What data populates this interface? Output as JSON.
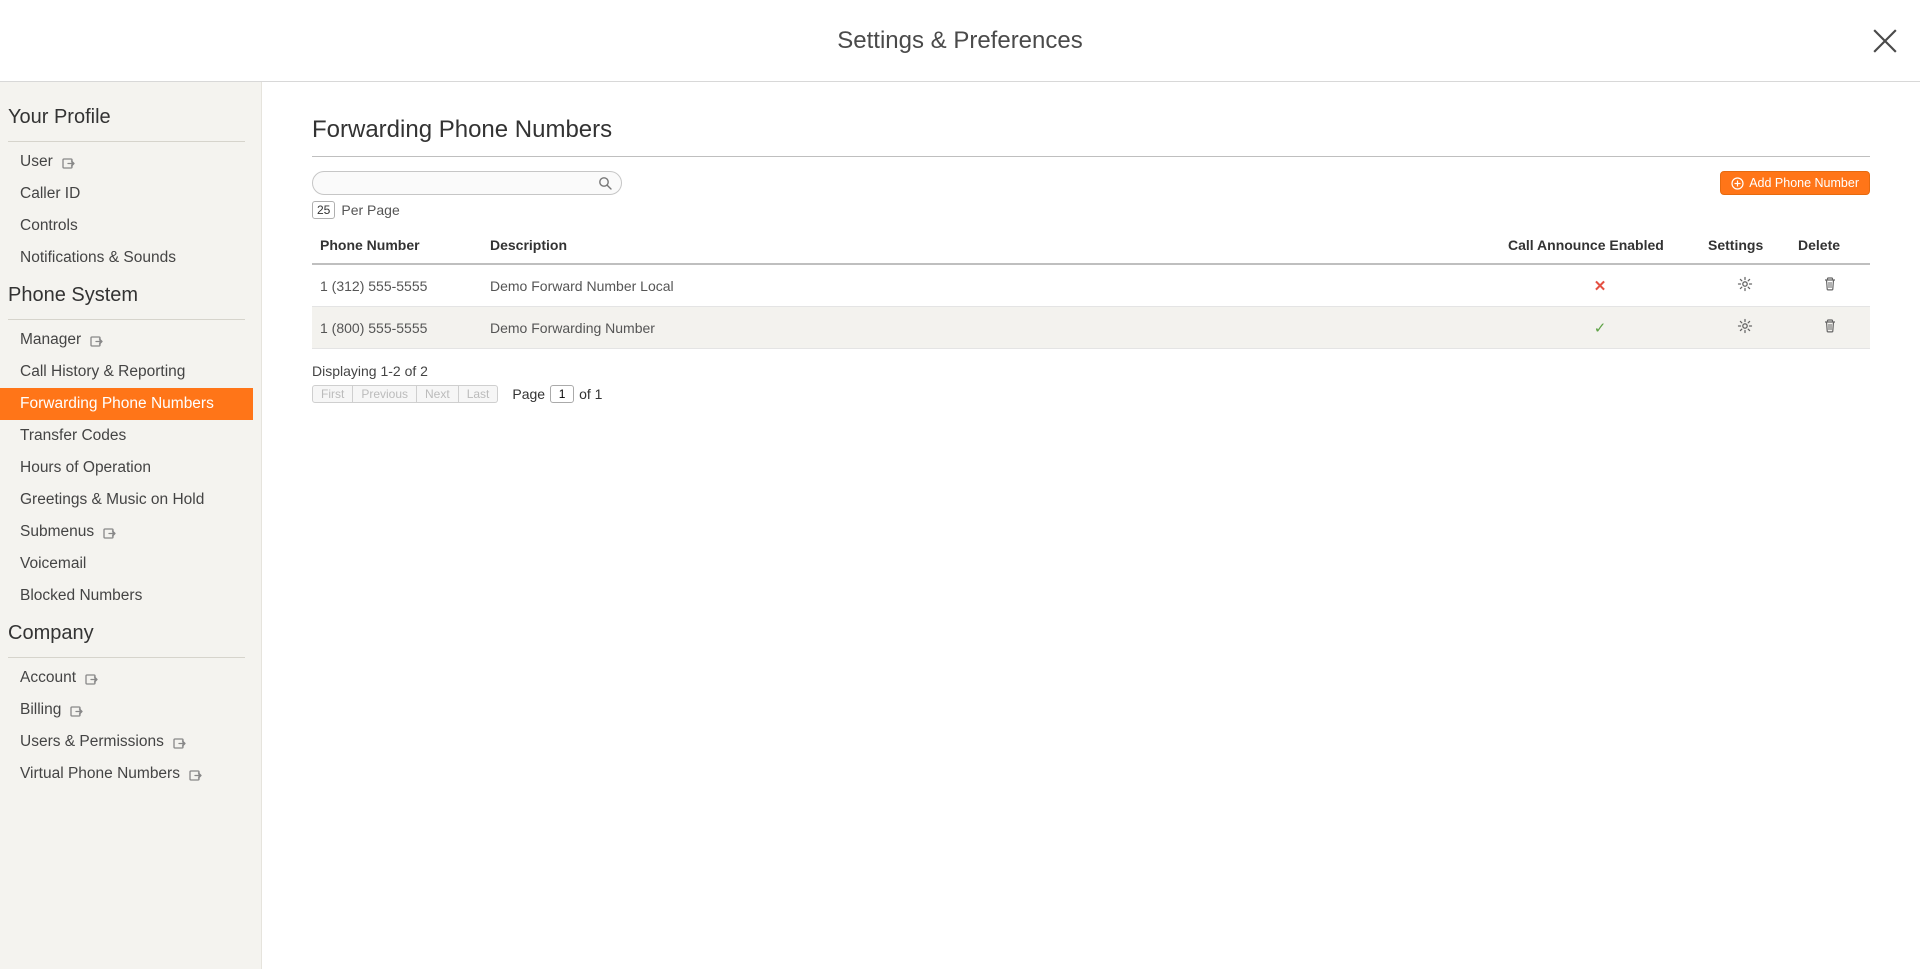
{
  "header": {
    "title": "Settings & Preferences"
  },
  "sidebar": {
    "sections": [
      {
        "title": "Your Profile",
        "items": [
          {
            "label": "User",
            "external": true,
            "active": false
          },
          {
            "label": "Caller ID",
            "external": false,
            "active": false
          },
          {
            "label": "Controls",
            "external": false,
            "active": false
          },
          {
            "label": "Notifications & Sounds",
            "external": false,
            "active": false
          }
        ]
      },
      {
        "title": "Phone System",
        "items": [
          {
            "label": "Manager",
            "external": true,
            "active": false
          },
          {
            "label": "Call History & Reporting",
            "external": false,
            "active": false
          },
          {
            "label": "Forwarding Phone Numbers",
            "external": false,
            "active": true
          },
          {
            "label": "Transfer Codes",
            "external": false,
            "active": false
          },
          {
            "label": "Hours of Operation",
            "external": false,
            "active": false
          },
          {
            "label": "Greetings & Music on Hold",
            "external": false,
            "active": false
          },
          {
            "label": "Submenus",
            "external": true,
            "active": false
          },
          {
            "label": "Voicemail",
            "external": false,
            "active": false
          },
          {
            "label": "Blocked Numbers",
            "external": false,
            "active": false
          }
        ]
      },
      {
        "title": "Company",
        "items": [
          {
            "label": "Account",
            "external": true,
            "active": false
          },
          {
            "label": "Billing",
            "external": true,
            "active": false
          },
          {
            "label": "Users & Permissions",
            "external": true,
            "active": false
          },
          {
            "label": "Virtual Phone Numbers",
            "external": true,
            "active": false
          }
        ]
      }
    ]
  },
  "main": {
    "title": "Forwarding Phone Numbers",
    "search_value": "",
    "per_page": "25",
    "per_page_label": "Per Page",
    "add_button": "Add Phone Number",
    "columns": {
      "phone": "Phone Number",
      "description": "Description",
      "announce": "Call Announce Enabled",
      "settings": "Settings",
      "delete": "Delete"
    },
    "rows": [
      {
        "phone": "1 (312) 555-5555",
        "description": "Demo Forward Number Local",
        "announce": false
      },
      {
        "phone": "1 (800) 555-5555",
        "description": "Demo Forwarding Number",
        "announce": true
      }
    ],
    "displaying": "Displaying 1-2 of 2",
    "pager": {
      "first": "First",
      "prev": "Previous",
      "next": "Next",
      "last": "Last",
      "page_label": "Page",
      "page_value": "1",
      "of_label": "of 1"
    }
  }
}
